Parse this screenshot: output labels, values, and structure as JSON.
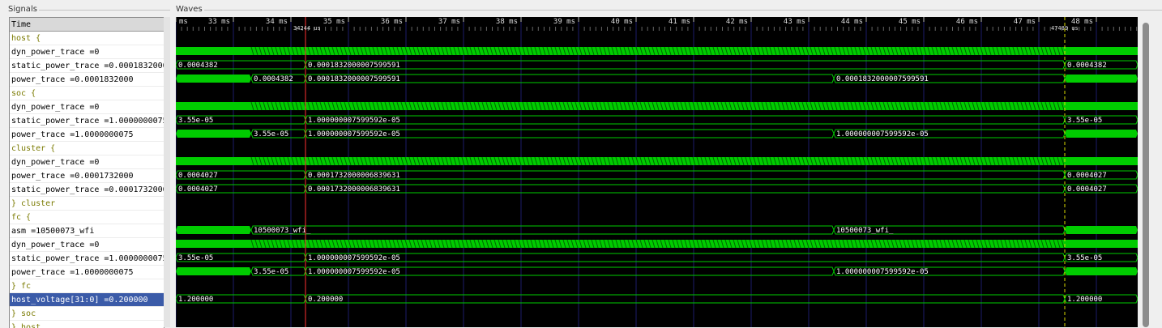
{
  "panels": {
    "signals_label": "Signals",
    "waves_label": "Waves"
  },
  "signals": {
    "header": "Time",
    "rows": [
      {
        "text": "host {",
        "kind": "scope"
      },
      {
        "text": "    dyn_power_trace =0",
        "kind": "signal"
      },
      {
        "text": "static_power_trace =0.0001832000",
        "kind": "signal"
      },
      {
        "text": "        power_trace =0.0001832000",
        "kind": "signal"
      },
      {
        "text": "soc {",
        "kind": "scope"
      },
      {
        "text": "    dyn_power_trace =0",
        "kind": "signal"
      },
      {
        "text": "static_power_trace =1.0000000075",
        "kind": "signal"
      },
      {
        "text": "        power_trace =1.0000000075",
        "kind": "signal"
      },
      {
        "text": "cluster {",
        "kind": "scope"
      },
      {
        "text": "    dyn_power_trace =0",
        "kind": "signal"
      },
      {
        "text": "        power_trace =0.0001732000",
        "kind": "signal"
      },
      {
        "text": "static_power_trace =0.0001732000",
        "kind": "signal"
      },
      {
        "text": "} cluster",
        "kind": "scope"
      },
      {
        "text": "fc {",
        "kind": "scope"
      },
      {
        "text": "                asm =10500073_wfi",
        "kind": "signal"
      },
      {
        "text": "    dyn_power_trace =0",
        "kind": "signal"
      },
      {
        "text": "static_power_trace =1.0000000075",
        "kind": "signal"
      },
      {
        "text": "        power_trace =1.0000000075",
        "kind": "signal"
      },
      {
        "text": "} fc",
        "kind": "scope"
      },
      {
        "text": "host_voltage[31:0] =0.200000",
        "kind": "selected"
      },
      {
        "text": "} soc",
        "kind": "scope"
      },
      {
        "text": "} host",
        "kind": "scope"
      }
    ]
  },
  "time_axis": {
    "ticks": [
      "ms",
      "33 ms",
      "34 ms",
      "35 ms",
      "36 ms",
      "37 ms",
      "38 ms",
      "39 ms",
      "40 ms",
      "41 ms",
      "42 ms",
      "43 ms",
      "44 ms",
      "45 ms",
      "46 ms",
      "47 ms",
      "48 ms",
      "4"
    ],
    "cursor_label": "34244 us",
    "marker_label": "47489 us"
  },
  "waves": [
    {
      "type": "empty"
    },
    {
      "type": "activity"
    },
    {
      "type": "bus",
      "segments": [
        {
          "from": 0,
          "to": 160,
          "label": "0.0004382"
        },
        {
          "from": 160,
          "to": 1097,
          "label": "0.0001832000007599591"
        },
        {
          "from": 1097,
          "to": 1187,
          "label": "0.0004382"
        }
      ]
    },
    {
      "type": "bus",
      "segments": [
        {
          "from": 0,
          "to": 93,
          "label": "",
          "fill": true
        },
        {
          "from": 93,
          "to": 160,
          "label": "0.0004382"
        },
        {
          "from": 160,
          "to": 812,
          "label": "0.0001832000007599591"
        },
        {
          "from": 812,
          "to": 1097,
          "label": "0.0001832000007599591"
        },
        {
          "from": 1097,
          "to": 1187,
          "label": "",
          "fill": true
        }
      ]
    },
    {
      "type": "empty"
    },
    {
      "type": "activity"
    },
    {
      "type": "bus",
      "segments": [
        {
          "from": 0,
          "to": 160,
          "label": "3.55e-05"
        },
        {
          "from": 160,
          "to": 1097,
          "label": "1.000000007599592e-05"
        },
        {
          "from": 1097,
          "to": 1187,
          "label": "3.55e-05"
        }
      ]
    },
    {
      "type": "bus",
      "segments": [
        {
          "from": 0,
          "to": 93,
          "label": "",
          "fill": true
        },
        {
          "from": 93,
          "to": 160,
          "label": "3.55e-05"
        },
        {
          "from": 160,
          "to": 812,
          "label": "1.000000007599592e-05"
        },
        {
          "from": 812,
          "to": 1097,
          "label": "1.000000007599592e-05"
        },
        {
          "from": 1097,
          "to": 1187,
          "label": "",
          "fill": true
        }
      ]
    },
    {
      "type": "empty"
    },
    {
      "type": "activity"
    },
    {
      "type": "bus",
      "segments": [
        {
          "from": 0,
          "to": 160,
          "label": "0.0004027"
        },
        {
          "from": 160,
          "to": 1097,
          "label": "0.0001732000006839631"
        },
        {
          "from": 1097,
          "to": 1187,
          "label": "0.0004027"
        }
      ]
    },
    {
      "type": "bus",
      "segments": [
        {
          "from": 0,
          "to": 160,
          "label": "0.0004027"
        },
        {
          "from": 160,
          "to": 1097,
          "label": "0.0001732000006839631"
        },
        {
          "from": 1097,
          "to": 1187,
          "label": "0.0004027"
        }
      ]
    },
    {
      "type": "empty"
    },
    {
      "type": "empty"
    },
    {
      "type": "bus",
      "segments": [
        {
          "from": 0,
          "to": 93,
          "label": "",
          "fill": true
        },
        {
          "from": 93,
          "to": 812,
          "label": "10500073_wfi_"
        },
        {
          "from": 812,
          "to": 1097,
          "label": "10500073_wfi_"
        },
        {
          "from": 1097,
          "to": 1187,
          "label": "",
          "fill": true
        }
      ]
    },
    {
      "type": "activity"
    },
    {
      "type": "bus",
      "segments": [
        {
          "from": 0,
          "to": 160,
          "label": "3.55e-05"
        },
        {
          "from": 160,
          "to": 1097,
          "label": "1.000000007599592e-05"
        },
        {
          "from": 1097,
          "to": 1187,
          "label": "3.55e-05"
        }
      ]
    },
    {
      "type": "bus",
      "segments": [
        {
          "from": 0,
          "to": 93,
          "label": "",
          "fill": true
        },
        {
          "from": 93,
          "to": 160,
          "label": "3.55e-05"
        },
        {
          "from": 160,
          "to": 812,
          "label": "1.000000007599592e-05"
        },
        {
          "from": 812,
          "to": 1097,
          "label": "1.000000007599592e-05"
        },
        {
          "from": 1097,
          "to": 1187,
          "label": "",
          "fill": true
        }
      ]
    },
    {
      "type": "empty"
    },
    {
      "type": "bus",
      "segments": [
        {
          "from": 0,
          "to": 160,
          "label": "1.200000"
        },
        {
          "from": 160,
          "to": 1097,
          "label": "0.200000"
        },
        {
          "from": 1097,
          "to": 1187,
          "label": "1.200000"
        }
      ]
    },
    {
      "type": "empty"
    },
    {
      "type": "empty"
    }
  ],
  "colors": {
    "wave": "#00cc00",
    "wave_text": "#ffffff",
    "grid": "#1c1c6a",
    "cursor": "#ff3030",
    "marker": "#d8d800",
    "scope_text": "#7a7a00",
    "selected_bg": "#3b5ba8"
  }
}
